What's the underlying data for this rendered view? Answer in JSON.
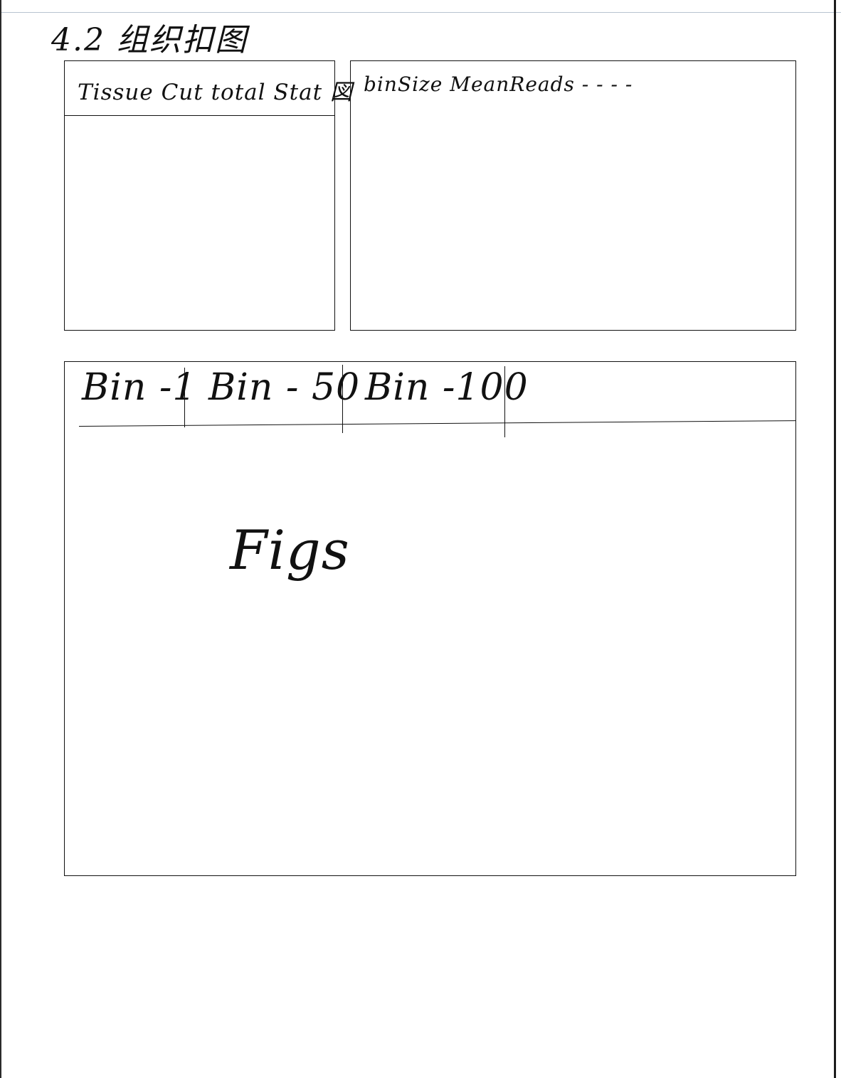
{
  "title": "4.2 组织扣图",
  "left_panel": {
    "header": "Tissue Cut total Stat 図"
  },
  "right_panel": {
    "header": "binSize  MeanReads  - - - -"
  },
  "bottom_panel": {
    "tabs": [
      "Bin -1",
      "Bin - 50",
      "Bin -100"
    ],
    "content": "Figs"
  }
}
